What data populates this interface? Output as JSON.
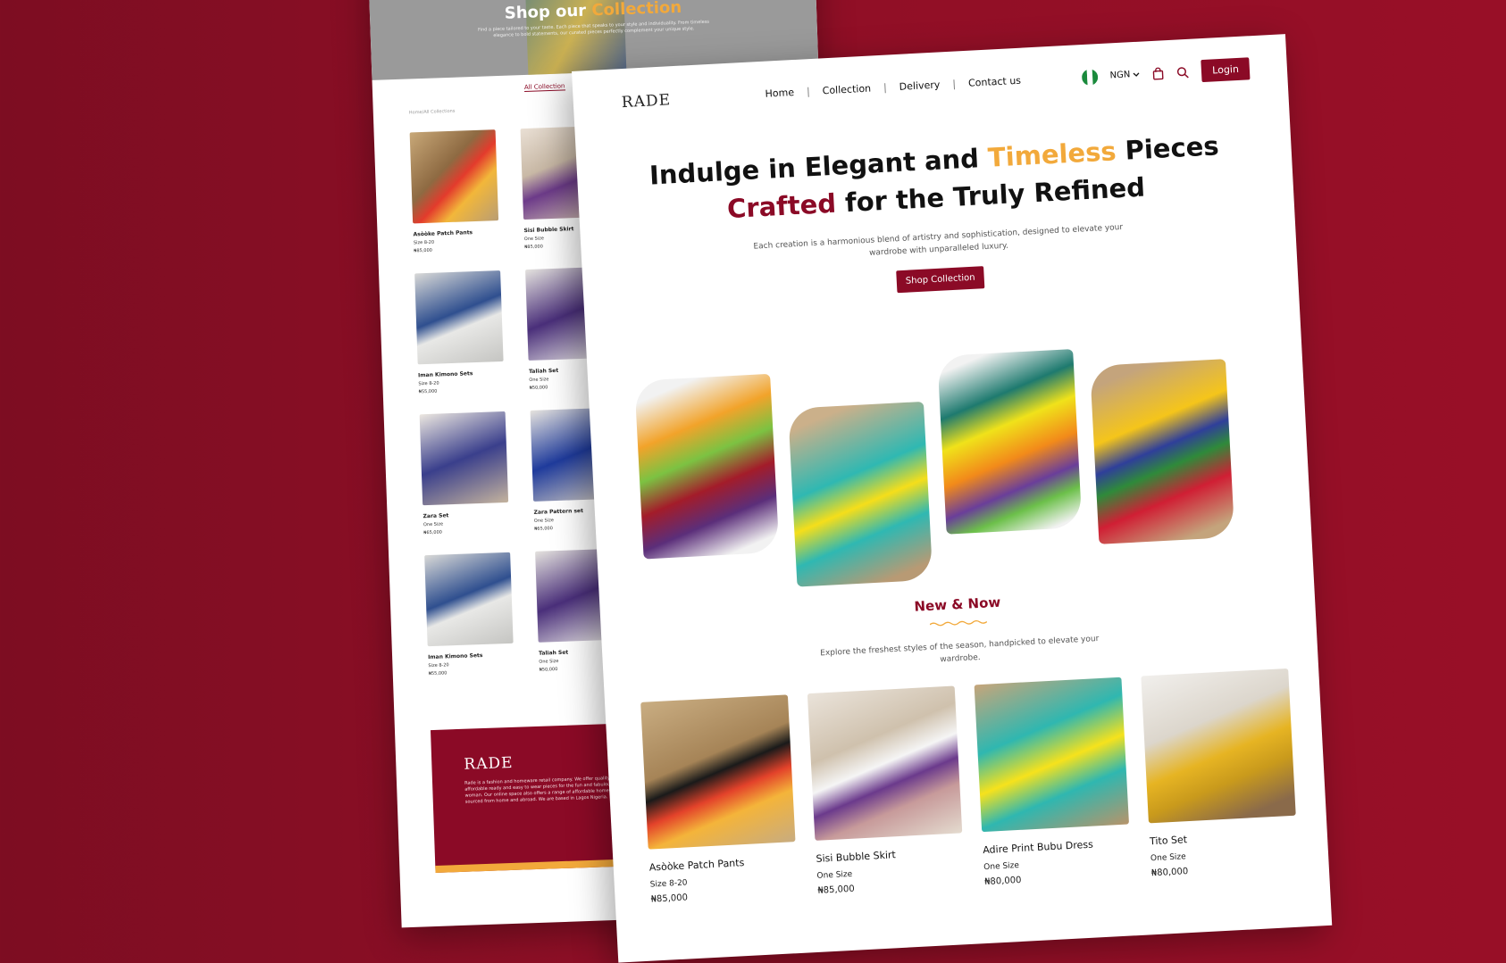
{
  "back_page": {
    "hero_title_lead": "Shop our",
    "hero_title_accent": "Collection",
    "hero_subtitle": "Find a piece tailored to your taste. Each piece that speaks to your style and individuality. From timeless elegance to bold statements, our curated pieces perfectly complement your unique style.",
    "tab_label": "All Collection",
    "breadcrumb": "Home/All Collections",
    "products": [
      {
        "name": "Asòòke Patch Pants",
        "size": "Size 8-20",
        "price": "₦85,000"
      },
      {
        "name": "Sisi Bubble Skirt",
        "size": "One Size",
        "price": "₦85,000"
      },
      {
        "name": "Iman Kimono Sets",
        "size": "Size 8-20",
        "price": "₦55,000"
      },
      {
        "name": "Taliah Set",
        "size": "One Size",
        "price": "₦50,000"
      },
      {
        "name": "Zara Set",
        "size": "One Size",
        "price": "₦65,000"
      },
      {
        "name": "Zara Pattern set",
        "size": "One Size",
        "price": "₦65,000"
      },
      {
        "name": "Iman Kimono Sets",
        "size": "Size 8-20",
        "price": "₦55,000"
      },
      {
        "name": "Taliah Set",
        "size": "One Size",
        "price": "₦50,000"
      }
    ],
    "footer": {
      "logo": "RADE",
      "description": "Rade is a fashion and homeware retail company. We offer quality affordable ready and easy to wear pieces for the fun and fabulous woman. Our online space also offers a range of affordable homeware sourced from home and abroad. We are based in Lagos Nigeria."
    }
  },
  "nav": {
    "logo": "RADE",
    "links": [
      "Home",
      "Collection",
      "Delivery",
      "Contact us"
    ],
    "currency": "NGN",
    "login": "Login"
  },
  "hero": {
    "line1_a": "Indulge in Elegant and",
    "line1_gold": "Timeless",
    "line1_b": "Pieces",
    "line2_wine": "Crafted",
    "line2_b": "for the Truly Refined",
    "subtitle": "Each creation is a harmonious blend of artistry and sophistication, designed to elevate your wardrobe with unparalleled luxury.",
    "cta": "Shop Collection"
  },
  "new_now": {
    "title": "New & Now",
    "subtitle": "Explore the freshest styles of the season, handpicked to elevate your wardrobe."
  },
  "products": [
    {
      "name": "Asòòke Patch Pants",
      "size": "Size 8-20",
      "price": "₦85,000"
    },
    {
      "name": "Sisi Bubble Skirt",
      "size": "One Size",
      "price": "₦85,000"
    },
    {
      "name": "Adire Print Bubu Dress",
      "size": "One Size",
      "price": "₦80,000"
    },
    {
      "name": "Tito Set",
      "size": "One Size",
      "price": "₦80,000"
    }
  ],
  "colors": {
    "brand": "#8b0a26",
    "accent": "#f2a93b",
    "background": "#8e0f26"
  }
}
